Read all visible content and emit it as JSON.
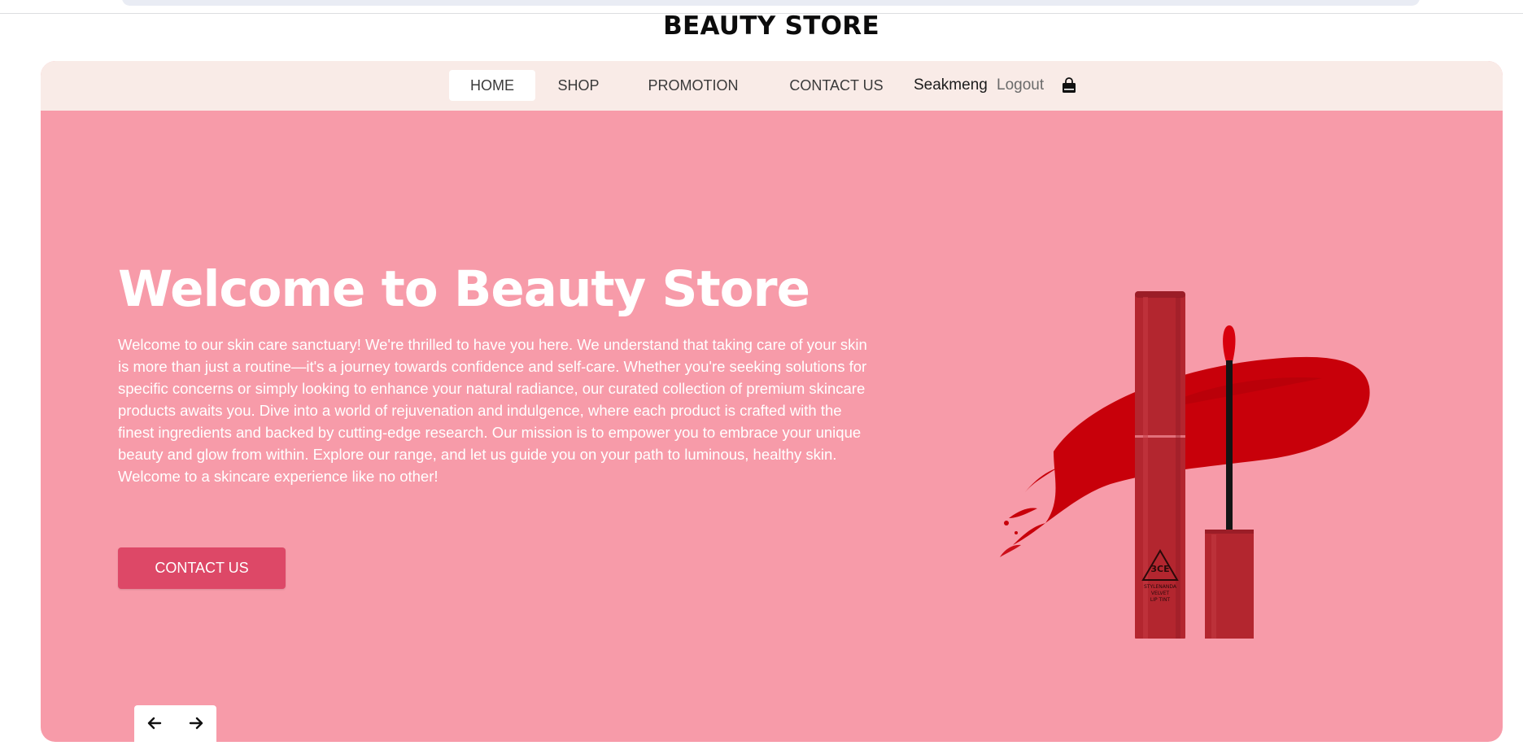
{
  "site": {
    "title": "BEAUTY STORE"
  },
  "nav": {
    "items": [
      {
        "label": "HOME",
        "active": true
      },
      {
        "label": "SHOP",
        "active": false
      },
      {
        "label": "PROMOTION",
        "active": false
      },
      {
        "label": "CONTACT US",
        "active": false
      }
    ],
    "user_name": "Seakmeng",
    "logout_label": "Logout",
    "cart_icon": "shopping-bag-icon"
  },
  "hero": {
    "title": "Welcome to Beauty Store",
    "text": "Welcome to our skin care sanctuary! We're thrilled to have you here. We understand that taking care of your skin is more than just a routine—it's a journey towards confidence and self-care. Whether you're seeking solutions for specific concerns or simply looking to enhance your natural radiance, our curated collection of premium skincare products awaits you. Dive into a world of rejuvenation and indulgence, where each product is crafted with the finest ingredients and backed by cutting-edge research. Our mission is to empower you to embrace your unique beauty and glow from within. Explore our range, and let us guide you on your path to luminous, healthy skin. Welcome to a skincare experience like no other!",
    "cta_label": "CONTACT US",
    "product_label": {
      "brand": "3CE",
      "line1": "STYLENANDA",
      "line2": "VELVET",
      "line3": "LIP TINT"
    }
  },
  "slider": {
    "prev_icon": "arrow-left-icon",
    "next_icon": "arrow-right-icon"
  },
  "colors": {
    "hero_bg": "#f79ba9",
    "nav_bg": "#f9ebe7",
    "cta_bg": "#dd4867",
    "lipstick": "#b3262f",
    "swatch": "#c8000a"
  }
}
